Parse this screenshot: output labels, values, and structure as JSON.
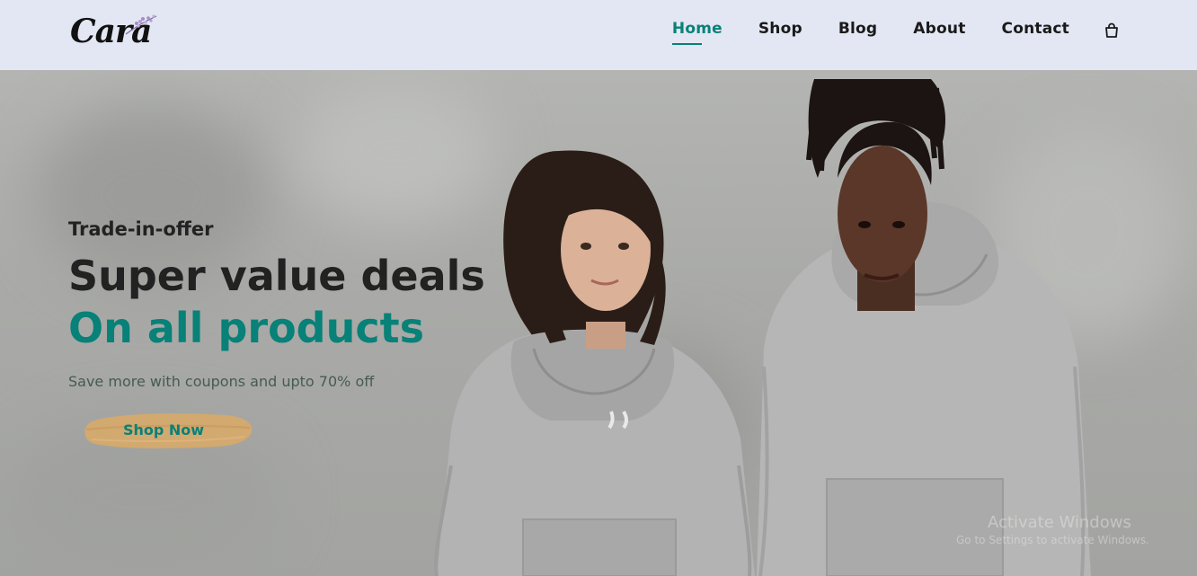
{
  "header": {
    "logo_text": "Cara",
    "nav": [
      {
        "label": "Home",
        "active": true
      },
      {
        "label": "Shop",
        "active": false
      },
      {
        "label": "Blog",
        "active": false
      },
      {
        "label": "About",
        "active": false
      },
      {
        "label": "Contact",
        "active": false
      }
    ],
    "cart_icon": "shopping-bag-icon"
  },
  "hero": {
    "tag": "Trade-in-offer",
    "headline_1": "Super value deals",
    "headline_2": "On all products",
    "subtext": "Save more with coupons and upto 70% off",
    "cta_label": "Shop Now"
  },
  "watermark": {
    "line1": "Activate Windows",
    "line2": "Go to Settings to activate Windows."
  },
  "colors": {
    "accent": "#088178",
    "header_bg": "#e3e6f3",
    "cta_brush": "#d6a96a",
    "heading": "#222222"
  }
}
